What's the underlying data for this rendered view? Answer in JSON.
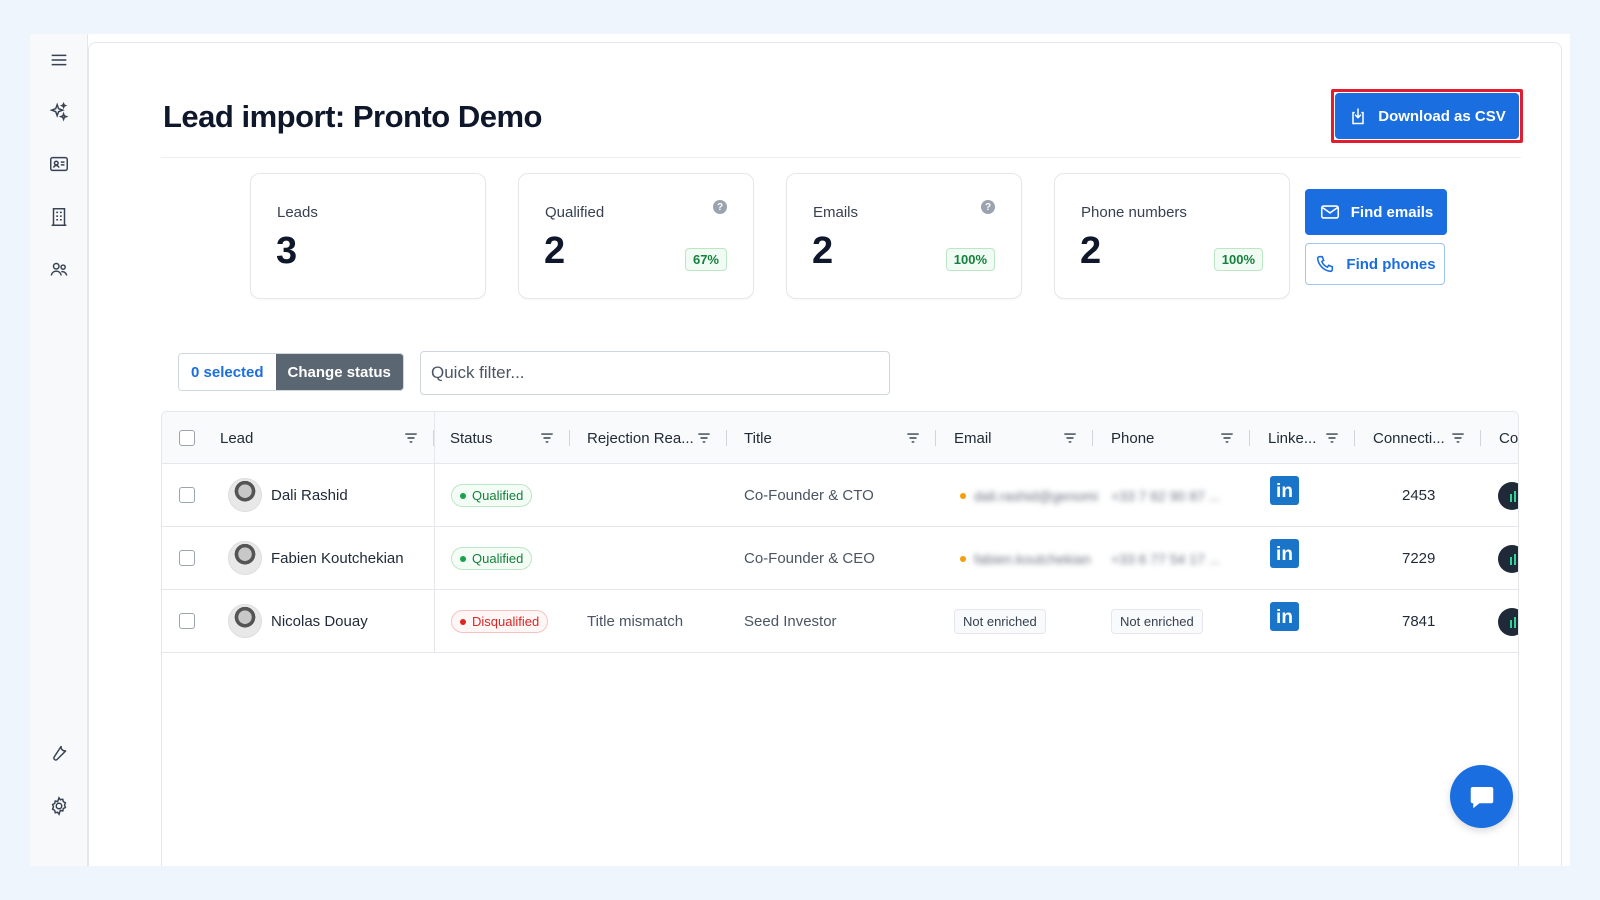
{
  "sidebar": {
    "icons": [
      "menu-icon",
      "sparkles-icon",
      "contact-card-icon",
      "building-icon",
      "users-icon",
      "wrench-icon",
      "gear-icon"
    ]
  },
  "header": {
    "title": "Lead import: Pronto Demo",
    "download_label": "Download as CSV"
  },
  "stats": [
    {
      "label": "Leads",
      "value": "3",
      "pct": ""
    },
    {
      "label": "Qualified",
      "value": "2",
      "pct": "67%"
    },
    {
      "label": "Emails",
      "value": "2",
      "pct": "100%"
    },
    {
      "label": "Phone numbers",
      "value": "2",
      "pct": "100%"
    }
  ],
  "actions": {
    "find_emails": "Find emails",
    "find_phones": "Find phones"
  },
  "toolbar": {
    "selected": "0 selected",
    "change_status": "Change status",
    "quick_filter_placeholder": "Quick filter..."
  },
  "table": {
    "columns": [
      "Lead",
      "Status",
      "Rejection Rea...",
      "Title",
      "Email",
      "Phone",
      "Linke...",
      "Connecti...",
      "Co"
    ],
    "rows": [
      {
        "lead": "Dali Rashid",
        "status": "Qualified",
        "rejection": "",
        "title": "Co-Founder & CTO",
        "email": "dali.rashid@genomi",
        "phone": "+33 7 62 90 87 ...",
        "connections": "2453"
      },
      {
        "lead": "Fabien Koutchekian",
        "status": "Qualified",
        "rejection": "",
        "title": "Co-Founder & CEO",
        "email": "fabien.koutchekian",
        "phone": "+33 6 77 54 17 ...",
        "connections": "7229"
      },
      {
        "lead": "Nicolas Douay",
        "status": "Disqualified",
        "rejection": "Title mismatch",
        "title": "Seed Investor",
        "email": "Not enriched",
        "phone": "Not enriched",
        "connections": "7841"
      }
    ]
  },
  "colors": {
    "primary": "#1a6ee0",
    "highlight": "#e11d2e",
    "qualified": "#16a34a",
    "disqualified": "#dc2626"
  }
}
